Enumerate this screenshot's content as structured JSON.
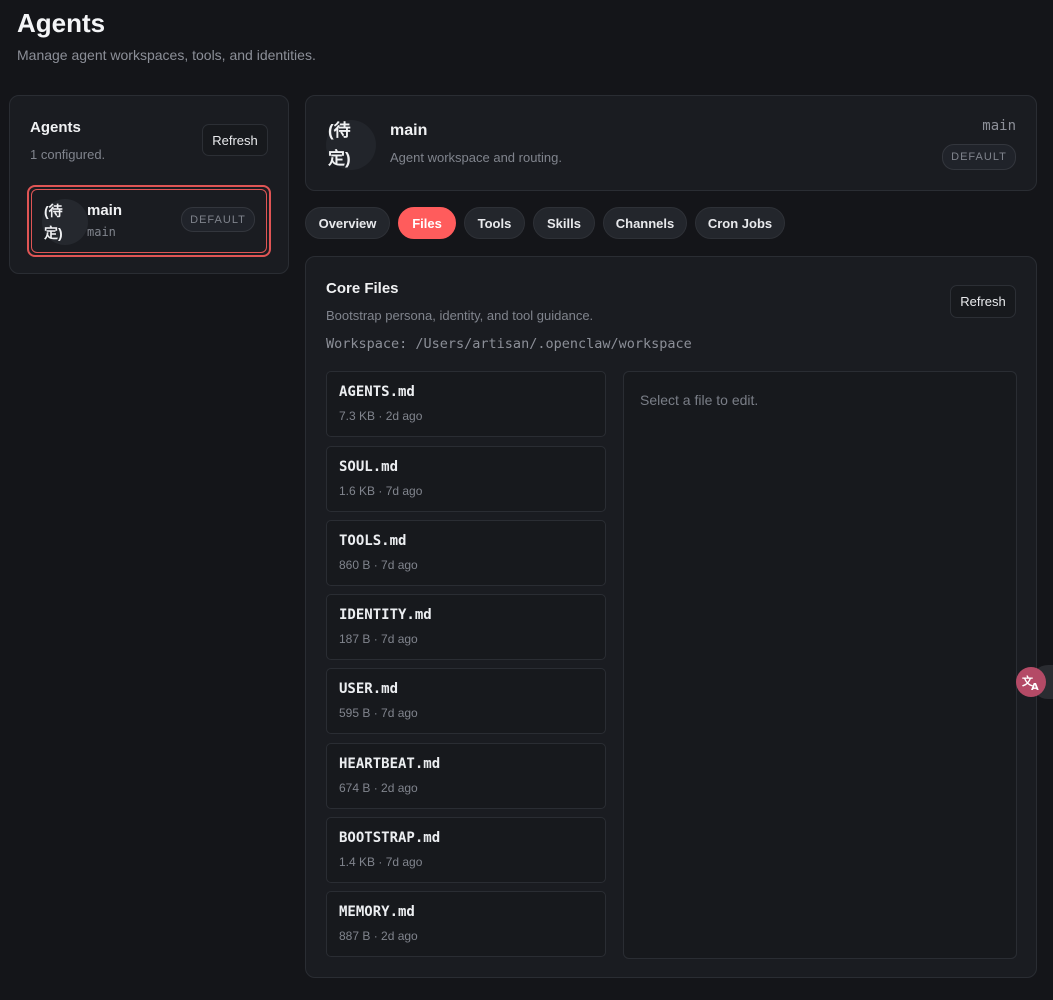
{
  "header": {
    "title": "Agents",
    "subtitle": "Manage agent workspaces, tools, and identities."
  },
  "sidebar": {
    "title": "Agents",
    "count_text": "1 configured.",
    "refresh_label": "Refresh",
    "agents": [
      {
        "avatar": "(待\n定)",
        "name": "main",
        "id": "main",
        "badge": "DEFAULT",
        "selected": true
      }
    ]
  },
  "agent_header": {
    "avatar": "(待\n定)",
    "name": "main",
    "description": "Agent workspace and routing.",
    "id": "main",
    "badge": "DEFAULT"
  },
  "tabs": [
    {
      "label": "Overview",
      "active": false
    },
    {
      "label": "Files",
      "active": true
    },
    {
      "label": "Tools",
      "active": false
    },
    {
      "label": "Skills",
      "active": false
    },
    {
      "label": "Channels",
      "active": false
    },
    {
      "label": "Cron Jobs",
      "active": false
    }
  ],
  "core_files": {
    "title": "Core Files",
    "description": "Bootstrap persona, identity, and tool guidance.",
    "workspace": "Workspace: /Users/artisan/.openclaw/workspace",
    "refresh_label": "Refresh",
    "files": [
      {
        "name": "AGENTS.md",
        "meta": "7.3 KB · 2d ago"
      },
      {
        "name": "SOUL.md",
        "meta": "1.6 KB · 7d ago"
      },
      {
        "name": "TOOLS.md",
        "meta": "860 B · 7d ago"
      },
      {
        "name": "IDENTITY.md",
        "meta": "187 B · 7d ago"
      },
      {
        "name": "USER.md",
        "meta": "595 B · 7d ago"
      },
      {
        "name": "HEARTBEAT.md",
        "meta": "674 B · 2d ago"
      },
      {
        "name": "BOOTSTRAP.md",
        "meta": "1.4 KB · 7d ago"
      },
      {
        "name": "MEMORY.md",
        "meta": "887 B · 2d ago"
      }
    ],
    "editor_placeholder": "Select a file to edit."
  },
  "icons": {
    "translate": "translate-icon"
  },
  "colors": {
    "accent": "#ff5c5c",
    "selected_border": "#e05555",
    "background": "#141519",
    "panel": "#1a1c21",
    "translate_fab": "#b44a66"
  }
}
